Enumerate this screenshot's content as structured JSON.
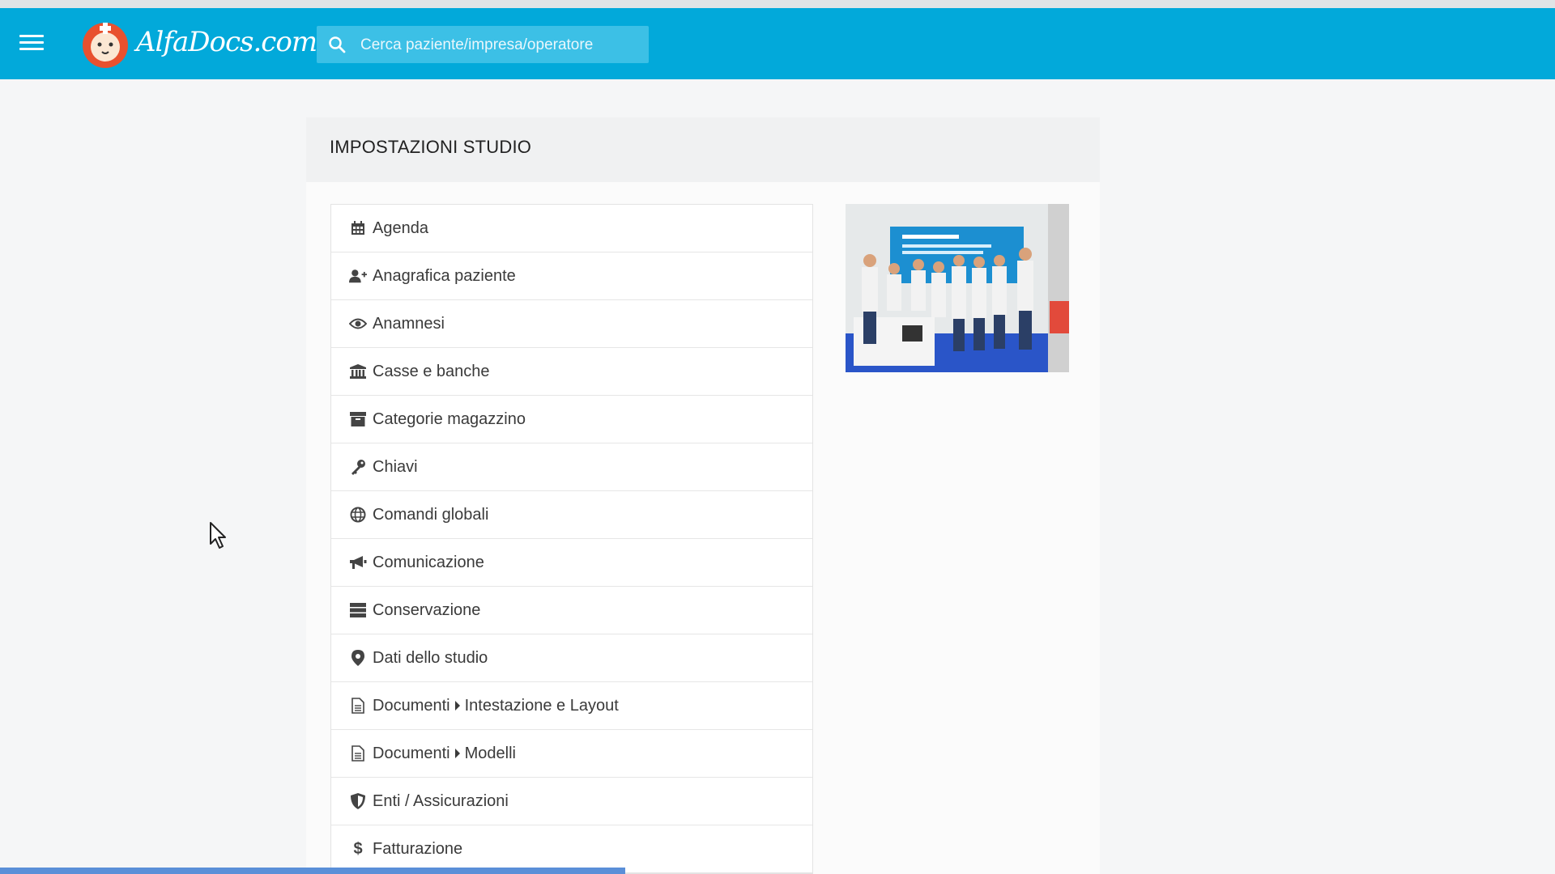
{
  "header": {
    "logo_text": "AlfaDocs.com",
    "search_placeholder": "Cerca paziente/impresa/operatore"
  },
  "panel": {
    "title": "IMPOSTAZIONI STUDIO"
  },
  "menu": [
    {
      "label": "Agenda",
      "icon": "calendar-icon"
    },
    {
      "label": "Anagrafica paziente",
      "icon": "user-plus-icon"
    },
    {
      "label": "Anamnesi",
      "icon": "eye-icon"
    },
    {
      "label": "Casse e banche",
      "icon": "bank-icon"
    },
    {
      "label": "Categorie magazzino",
      "icon": "archive-icon"
    },
    {
      "label": "Chiavi",
      "icon": "key-icon"
    },
    {
      "label": "Comandi globali",
      "icon": "globe-icon"
    },
    {
      "label": "Comunicazione",
      "icon": "megaphone-icon"
    },
    {
      "label": "Conservazione",
      "icon": "server-icon"
    },
    {
      "label": "Dati dello studio",
      "icon": "map-marker-icon"
    },
    {
      "label": "Documenti",
      "sub": "Intestazione e Layout",
      "icon": "document-icon"
    },
    {
      "label": "Documenti",
      "sub": "Modelli",
      "icon": "document-icon"
    },
    {
      "label": "Enti / Assicurazioni",
      "icon": "shield-icon"
    },
    {
      "label": "Fatturazione",
      "icon": "dollar-icon"
    }
  ],
  "colors": {
    "header": "#02a9da",
    "search": "#3cc0e6",
    "progress": "#5a8fd8"
  }
}
